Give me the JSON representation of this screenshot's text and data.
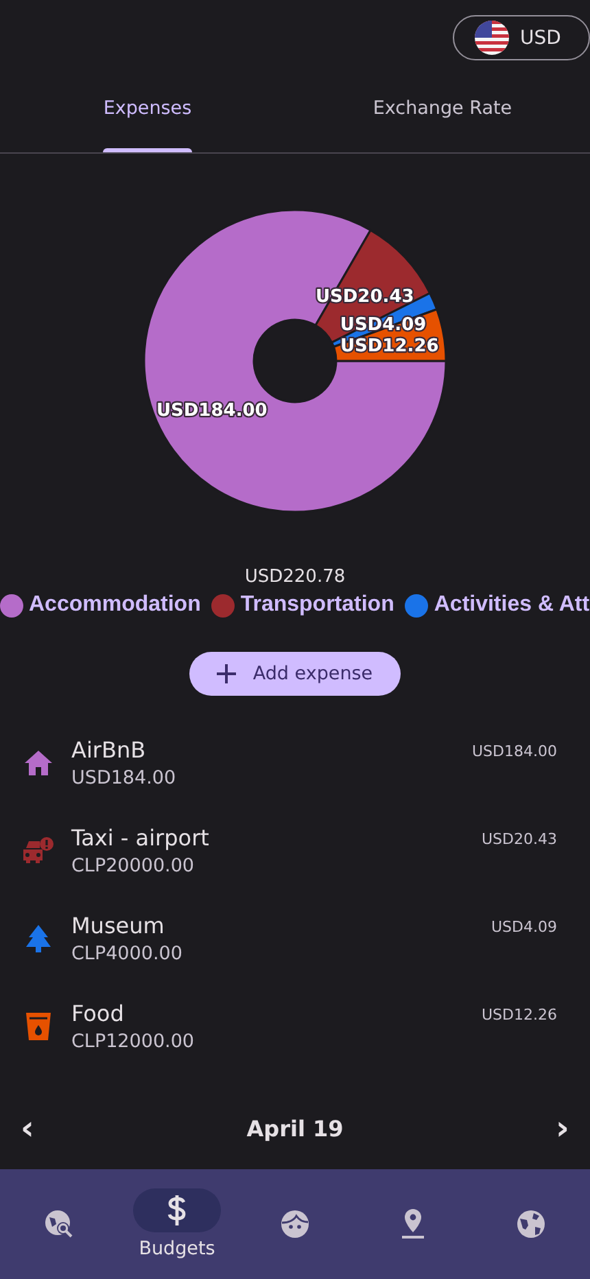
{
  "currency": {
    "label": "USD"
  },
  "tabs": [
    {
      "label": "Expenses",
      "selected": true
    },
    {
      "label": "Exchange Rate",
      "selected": false
    }
  ],
  "chart": {
    "chart_data": {
      "type": "donut",
      "values": [
        184.0,
        20.43,
        4.09,
        12.26
      ],
      "value_labels": [
        "USD184.00",
        "USD20.43",
        "USD4.09",
        "USD12.26"
      ]
    },
    "total": "USD220.78"
  },
  "legend": [
    {
      "label": "Accommodation",
      "color": "#b56cc9"
    },
    {
      "label": "Transportation",
      "color": "#9c2a2e"
    },
    {
      "label": "Activities & Att",
      "color": "#1a73e8"
    }
  ],
  "add_button": {
    "label": "Add expense"
  },
  "expenses": [
    {
      "kind": "house",
      "title": "AirBnB",
      "amount": "USD184.00",
      "converted": "USD184.00",
      "color": "#b56cc9"
    },
    {
      "kind": "car",
      "title": "Taxi - airport",
      "amount": "CLP20000.00",
      "converted": "USD20.43",
      "color": "#9c2a2e"
    },
    {
      "kind": "tree",
      "title": "Museum",
      "amount": "CLP4000.00",
      "converted": "USD4.09",
      "color": "#1a73e8"
    },
    {
      "kind": "drink",
      "title": "Food",
      "amount": "CLP12000.00",
      "converted": "USD12.26",
      "color": "#e65100"
    }
  ],
  "date_nav": {
    "prev": "‹",
    "label": "April 19",
    "next": "›"
  },
  "bottom_nav": [
    {
      "kind": "explore",
      "selected": false
    },
    {
      "kind": "budget",
      "label": "Budgets",
      "selected": true
    },
    {
      "kind": "face",
      "selected": false
    },
    {
      "kind": "pin",
      "selected": false
    },
    {
      "kind": "globe",
      "selected": false
    }
  ]
}
